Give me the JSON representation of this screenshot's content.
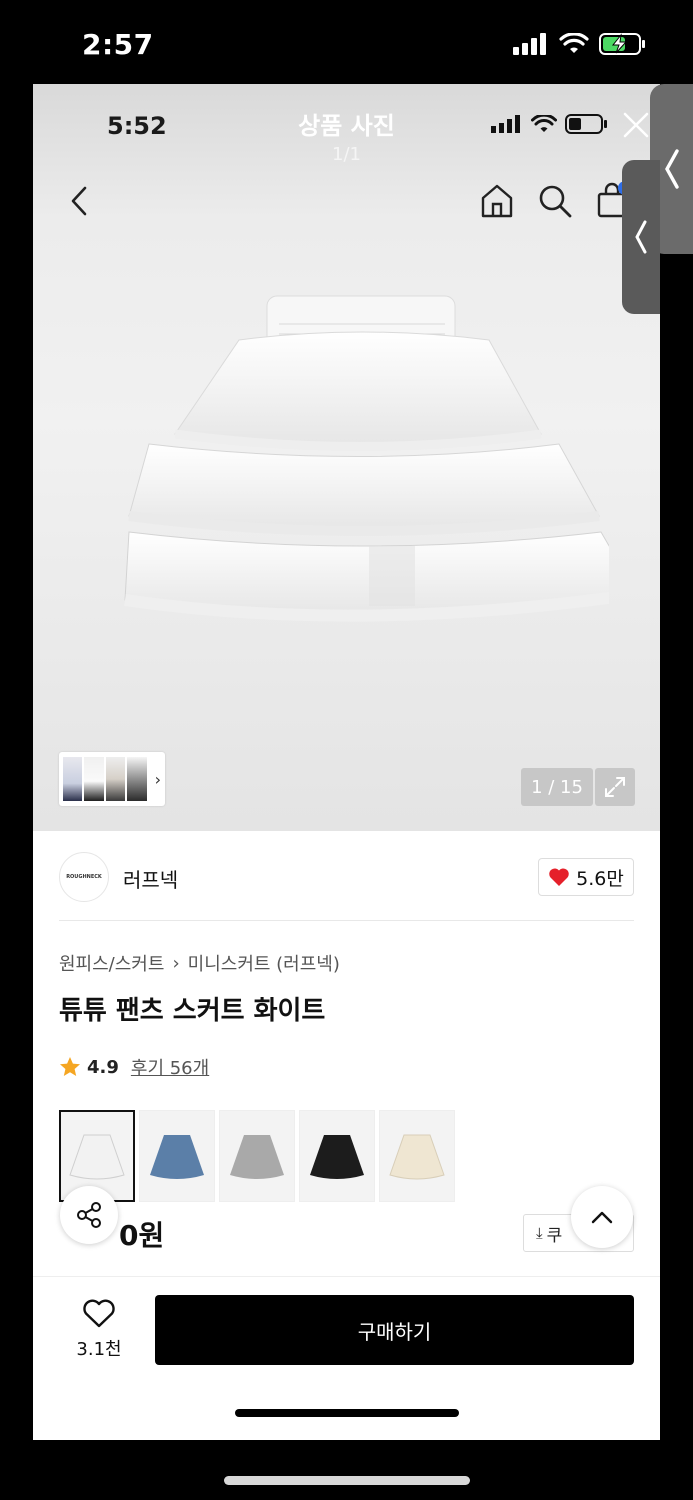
{
  "outer_status": {
    "time": "2:57"
  },
  "viewer": {
    "status_time": "5:52",
    "title": "상품 사진",
    "count": "1/1",
    "image_counter": "1 / 15",
    "icons": [
      "chevron-left-icon",
      "home-icon",
      "search-icon",
      "bag-icon",
      "close-icon",
      "expand-icon"
    ]
  },
  "seller": {
    "logo_text": "ROUGHNECK",
    "name": "러프넥",
    "likes": "5.6만"
  },
  "product": {
    "breadcrumb": [
      "원피스/스커트",
      "미니스커트 (러프넥)"
    ],
    "title": "튜튜 팬츠 스커트 화이트",
    "rating": "4.9",
    "reviews": "후기 56개",
    "colors": [
      {
        "name": "white",
        "color": "#f2f2f2"
      },
      {
        "name": "blue",
        "color": "#5b7fa8"
      },
      {
        "name": "gray",
        "color": "#a9a9a9"
      },
      {
        "name": "black",
        "color": "#1c1c1c"
      },
      {
        "name": "cream",
        "color": "#efe6d2"
      }
    ],
    "price": "0원",
    "coupon": "쿠"
  },
  "bottom": {
    "wish_count": "3.1천",
    "buy_label": "구매하기"
  },
  "colors": {
    "heart": "#e5202a",
    "star": "#f5a623",
    "buy_bg": "#000000"
  }
}
